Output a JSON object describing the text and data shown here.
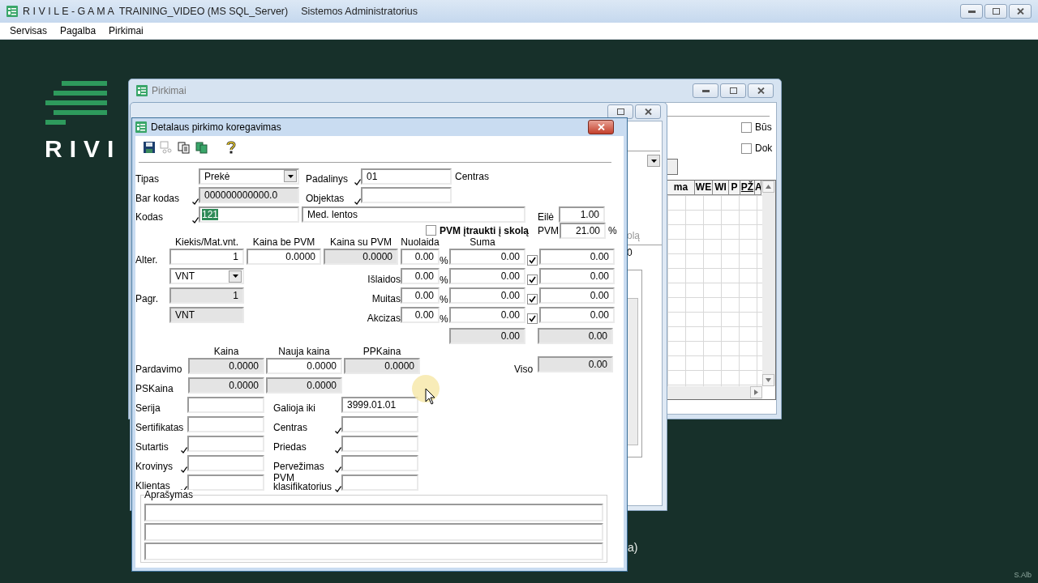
{
  "app": {
    "title": "R I V I L E - G A M A  TRAINING_VIDEO (MS SQL_Server)",
    "user": "Sistemos Administratorius"
  },
  "menu": [
    "Servisas",
    "Pagalba",
    "Pirkimai"
  ],
  "logo": {
    "text": "RIVI"
  },
  "purchases_window": {
    "title": "Pirkimai",
    "options": [
      {
        "label": "Būs",
        "checked": false
      },
      {
        "label": "Dok",
        "checked": false
      }
    ],
    "grid_columns": [
      {
        "label": "ma",
        "sorted": false
      },
      {
        "label": "WE",
        "sorted": false
      },
      {
        "label": "WI",
        "sorted": false
      },
      {
        "label": "P",
        "sorted": false
      },
      {
        "label": "PŽ",
        "sorted": true
      },
      {
        "label": "A",
        "sorted": false
      }
    ]
  },
  "behind_window": {
    "fragments": [
      "olą",
      "0"
    ]
  },
  "desktop_fragment": "a)",
  "corner_mark": "S.Alb",
  "dialog": {
    "title": "Detalaus pirkimo koregavimas",
    "tipas": {
      "label": "Tipas",
      "value": "Prekė"
    },
    "padalinys": {
      "label": "Padalinys",
      "lookup": true,
      "value": "01",
      "name": "Centras"
    },
    "bar_kodas": {
      "label": "Bar kodas",
      "lookup": true,
      "value": "000000000000.0",
      "readonly": true
    },
    "objektas": {
      "label": "Objektas",
      "lookup": true
    },
    "kodas": {
      "label": "Kodas",
      "lookup": true,
      "value": "121",
      "value_selected": true,
      "name": "Med. lentos"
    },
    "eile": {
      "label": "Eilė",
      "value": "1.00"
    },
    "pvm_skola": {
      "label": "PVM įtraukti į skolą",
      "checked": false
    },
    "pvm": {
      "label": "PVM",
      "value": "21.00",
      "unit": "%"
    },
    "amount_headers": [
      "Kiekis/Mat.vnt.",
      "Kaina be PVM",
      "Kaina su PVM",
      "Nuolaida",
      "Suma"
    ],
    "alter": {
      "label": "Alter.",
      "kiekis": "1",
      "kaina_be_pvm": "0.0000",
      "kaina_su_pvm": "0.0000",
      "unit": "VNT"
    },
    "pagr": {
      "label": "Pagr.",
      "kiekis": "1",
      "unit": "VNT"
    },
    "cost_rows": [
      {
        "percent": "0.00",
        "unit": "%",
        "sum": "0.00",
        "checked": true,
        "total": "0.00"
      },
      {
        "label": "Išlaidos",
        "percent": "0.00",
        "unit": "%",
        "sum": "0.00",
        "checked": true,
        "total": "0.00"
      },
      {
        "label": "Muitas",
        "percent": "0.00",
        "unit": "%",
        "sum": "0.00",
        "checked": true,
        "total": "0.00"
      },
      {
        "label": "Akcizas",
        "percent": "0.00",
        "unit": "%",
        "sum": "0.00",
        "checked": true,
        "total": "0.00"
      }
    ],
    "cost_totals": [
      "0.00",
      "0.00"
    ],
    "price_headers": [
      "Kaina",
      "Nauja kaina",
      "PPKaina"
    ],
    "pardavimo": {
      "label": "Pardavimo",
      "values": [
        {
          "value": "0.0000",
          "readonly": true
        },
        {
          "value": "0.0000",
          "readonly": false
        },
        {
          "value": "0.0000",
          "readonly": true
        }
      ]
    },
    "viso": {
      "label": "Viso",
      "value": "0.00"
    },
    "pskaina": {
      "label": "PSKaina",
      "values": [
        {
          "value": "0.0000",
          "readonly": true
        },
        {
          "value": "0.0000",
          "readonly": true
        }
      ]
    },
    "extra_left": [
      {
        "label": "Serija",
        "lookup": false
      },
      {
        "label": "Sertifikatas",
        "lookup": false
      },
      {
        "label": "Sutartis",
        "lookup": true
      },
      {
        "label": "Krovinys",
        "lookup": true
      },
      {
        "label": "Klientas",
        "lookup": true
      }
    ],
    "extra_right": [
      {
        "label": "Galioja iki",
        "lookup": false,
        "value": "3999.01.01"
      },
      {
        "label": "Centras",
        "lookup": true
      },
      {
        "label": "Priedas",
        "lookup": true
      },
      {
        "label": "Pervežimas",
        "lookup": true
      },
      {
        "label": "PVM klasifikatorius",
        "lookup": true
      }
    ],
    "aprasymas": {
      "label": "Aprašymas"
    }
  }
}
